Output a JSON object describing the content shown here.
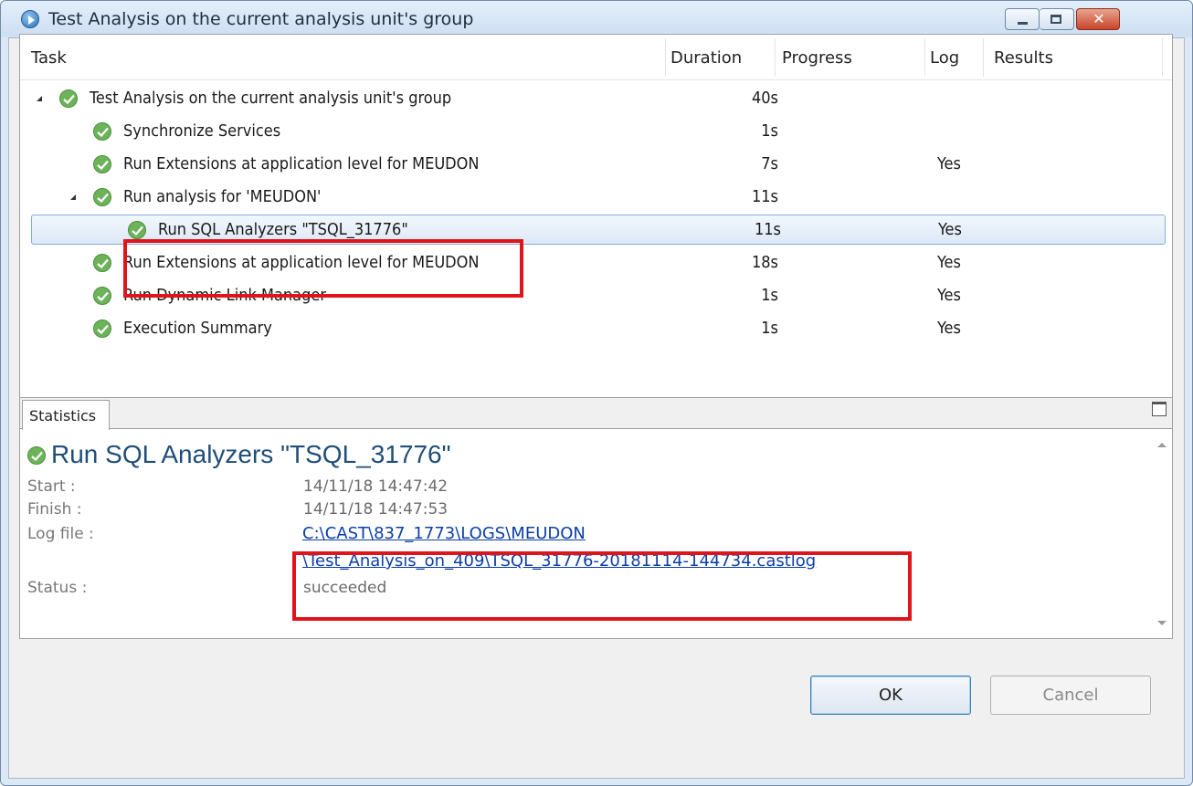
{
  "window": {
    "title": "Test Analysis on the current analysis unit's group",
    "controls": {
      "minimize": "minimize",
      "maximize": "maximize",
      "close": "✕"
    }
  },
  "task_table": {
    "columns": [
      "Task",
      "Duration",
      "Progress",
      "Log",
      "Results"
    ],
    "rows": [
      {
        "task": "Test Analysis on the current analysis unit's group",
        "duration": "40s",
        "log": "",
        "expanded": true
      },
      {
        "task": "Synchronize Services",
        "duration": "1s",
        "log": ""
      },
      {
        "task": "Run Extensions at application level for MEUDON",
        "duration": "7s",
        "log": "Yes"
      },
      {
        "task": "Run analysis for 'MEUDON'",
        "duration": "11s",
        "log": "",
        "expanded": true
      },
      {
        "task": "Run SQL Analyzers \"TSQL_31776\"",
        "duration": "11s",
        "log": "Yes",
        "selected": true
      },
      {
        "task": "Run Extensions at application level for MEUDON",
        "duration": "18s",
        "log": "Yes"
      },
      {
        "task": "Run Dynamic Link Manager",
        "duration": "1s",
        "log": "Yes"
      },
      {
        "task": "Execution Summary",
        "duration": "1s",
        "log": "Yes"
      }
    ]
  },
  "statistics": {
    "tab_label": "Statistics",
    "title": "Run SQL Analyzers \"TSQL_31776\"",
    "start_label": "Start :",
    "start_value": "14/11/18 14:47:42",
    "finish_label": "Finish :",
    "finish_value": "14/11/18 14:47:53",
    "log_label": "Log file :",
    "log_line1": "C:\\CAST\\837_1773\\LOGS\\MEUDON",
    "log_line2": "\\Test_Analysis_on_409\\TSQL_31776-20181114-144734.castlog",
    "status_label": "Status :",
    "status_value": "succeeded"
  },
  "buttons": {
    "ok": "OK",
    "cancel": "Cancel"
  },
  "colors": {
    "highlight": "#e0141b",
    "success": "#6cb35a",
    "link": "#0b3ea8"
  }
}
